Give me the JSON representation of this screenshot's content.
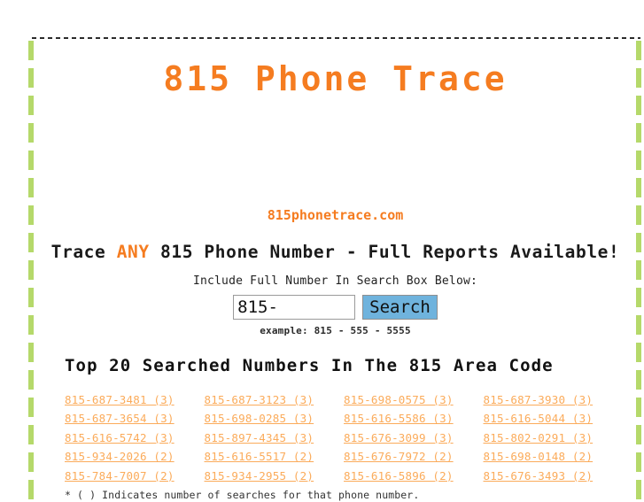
{
  "site": {
    "title": "815 Phone Trace",
    "domain": "815phonetrace.com",
    "accent_orange": "#f57c20",
    "link_orange": "#fbab5a",
    "border_green": "#b5d96a",
    "button_blue": "#6fb3dd"
  },
  "tagline": {
    "before": "Trace ",
    "highlight": "ANY",
    "after": " 815 Phone Number - Full Reports Available!"
  },
  "search": {
    "prompt": "Include Full Number In Search Box Below:",
    "value": "815-",
    "placeholder": "815-",
    "button_label": "Search",
    "example": "example: 815 - 555 - 5555"
  },
  "list": {
    "heading": "Top 20 Searched Numbers In The 815 Area Code",
    "footnote": "* ( ) Indicates number of searches for that phone number.",
    "rows": [
      [
        {
          "number": "815-687-3481",
          "count": "(3)",
          "label": "815-687-3481 (3)"
        },
        {
          "number": "815-687-3123",
          "count": "(3)",
          "label": "815-687-3123 (3)"
        },
        {
          "number": "815-698-0575",
          "count": "(3)",
          "label": "815-698-0575 (3)"
        },
        {
          "number": "815-687-3930",
          "count": "(3)",
          "label": "815-687-3930 (3)"
        }
      ],
      [
        {
          "number": "815-687-3654",
          "count": "(3)",
          "label": "815-687-3654 (3)"
        },
        {
          "number": "815-698-0285",
          "count": "(3)",
          "label": "815-698-0285 (3)"
        },
        {
          "number": "815-616-5586",
          "count": "(3)",
          "label": "815-616-5586 (3)"
        },
        {
          "number": "815-616-5044",
          "count": "(3)",
          "label": "815-616-5044 (3)"
        }
      ],
      [
        {
          "number": "815-616-5742",
          "count": "(3)",
          "label": "815-616-5742 (3)"
        },
        {
          "number": "815-897-4345",
          "count": "(3)",
          "label": "815-897-4345 (3)"
        },
        {
          "number": "815-676-3099",
          "count": "(3)",
          "label": "815-676-3099 (3)"
        },
        {
          "number": "815-802-0291",
          "count": "(3)",
          "label": "815-802-0291 (3)"
        }
      ],
      [
        {
          "number": "815-934-2026",
          "count": "(2)",
          "label": "815-934-2026 (2)"
        },
        {
          "number": "815-616-5517",
          "count": "(2)",
          "label": "815-616-5517 (2)"
        },
        {
          "number": "815-676-7972",
          "count": "(2)",
          "label": "815-676-7972 (2)"
        },
        {
          "number": "815-698-0148",
          "count": "(2)",
          "label": "815-698-0148 (2)"
        }
      ],
      [
        {
          "number": "815-784-7007",
          "count": "(2)",
          "label": "815-784-7007 (2)"
        },
        {
          "number": "815-934-2955",
          "count": "(2)",
          "label": "815-934-2955 (2)"
        },
        {
          "number": "815-616-5896",
          "count": "(2)",
          "label": "815-616-5896 (2)"
        },
        {
          "number": "815-676-3493",
          "count": "(2)",
          "label": "815-676-3493 (2)"
        }
      ]
    ]
  }
}
